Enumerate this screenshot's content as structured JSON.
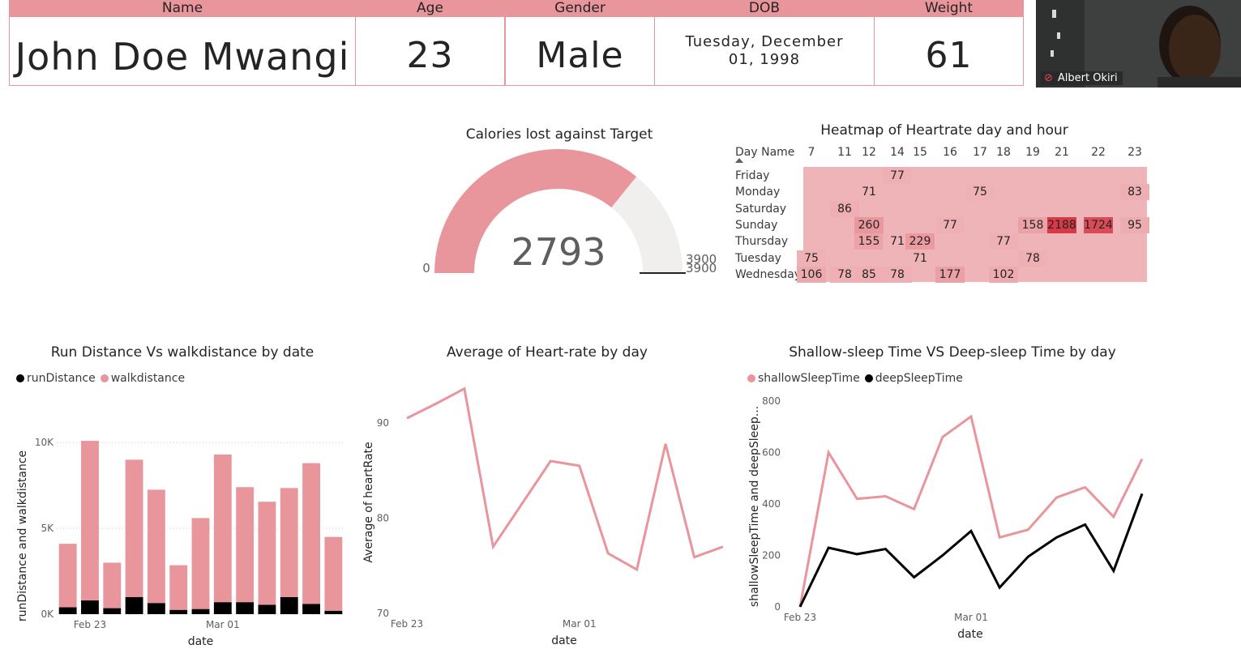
{
  "cards": [
    {
      "label": "Name",
      "value": "John Doe Mwangi"
    },
    {
      "label": "Age",
      "value": "23"
    },
    {
      "label": "Gender",
      "value": "Male"
    },
    {
      "label": "DOB",
      "value": "Tuesday, December 01, 1998"
    },
    {
      "label": "Weight",
      "value": "61"
    }
  ],
  "webcam": {
    "participant": "Albert Okiri"
  },
  "gauge": {
    "title": "Calories lost against Target",
    "value": 2793,
    "value_label": "2793",
    "min": 0,
    "min_label": "0",
    "max": 3900,
    "max_label": "3900",
    "target": 3900,
    "target_label": "3900",
    "fill_color": "#e8959b",
    "track_color": "#f0efee"
  },
  "heatmap": {
    "title": "Heatmap of Heartrate day and hour",
    "row_header": "Day Name",
    "columns": [
      "7",
      "11",
      "12",
      "14",
      "15",
      "16",
      "17",
      "18",
      "19",
      "21",
      "22",
      "23"
    ],
    "rows": [
      "Friday",
      "Monday",
      "Saturday",
      "Sunday",
      "Thursday",
      "Tuesday",
      "Wednesday"
    ],
    "cells": [
      {
        "row": 0,
        "col": 3,
        "value": "77"
      },
      {
        "row": 1,
        "col": 2,
        "value": "71"
      },
      {
        "row": 1,
        "col": 6,
        "value": "75"
      },
      {
        "row": 1,
        "col": 11,
        "value": "83"
      },
      {
        "row": 2,
        "col": 1,
        "value": "86"
      },
      {
        "row": 3,
        "col": 2,
        "value": "260"
      },
      {
        "row": 3,
        "col": 5,
        "value": "77"
      },
      {
        "row": 3,
        "col": 8,
        "value": "158"
      },
      {
        "row": 3,
        "col": 9,
        "value": "2188"
      },
      {
        "row": 3,
        "col": 10,
        "value": "1724"
      },
      {
        "row": 3,
        "col": 11,
        "value": "95"
      },
      {
        "row": 4,
        "col": 2,
        "value": "155"
      },
      {
        "row": 4,
        "col": 3,
        "value": "71"
      },
      {
        "row": 4,
        "col": 4,
        "value": "229"
      },
      {
        "row": 4,
        "col": 7,
        "value": "77"
      },
      {
        "row": 5,
        "col": 0,
        "value": "75"
      },
      {
        "row": 5,
        "col": 4,
        "value": "71"
      },
      {
        "row": 5,
        "col": 8,
        "value": "78"
      },
      {
        "row": 6,
        "col": 0,
        "value": "106"
      },
      {
        "row": 6,
        "col": 1,
        "value": "78"
      },
      {
        "row": 6,
        "col": 2,
        "value": "85"
      },
      {
        "row": 6,
        "col": 3,
        "value": "78"
      },
      {
        "row": 6,
        "col": 5,
        "value": "177"
      },
      {
        "row": 6,
        "col": 7,
        "value": "102"
      }
    ]
  },
  "chart_data": [
    {
      "type": "bar",
      "stacked": true,
      "title": "Run Distance Vs walkdistance by date",
      "xlabel": "date",
      "ylabel": "runDistance and walkdistance",
      "x_tick_labels": [
        "Feb 23",
        "Mar 01"
      ],
      "y_tick_labels": [
        "0K",
        "5K",
        "10K"
      ],
      "ylim": [
        0,
        11000
      ],
      "categories": [
        "Feb 22",
        "Feb 23",
        "Feb 24",
        "Feb 25",
        "Feb 26",
        "Feb 27",
        "Feb 28",
        "Mar 01",
        "Mar 02",
        "Mar 03",
        "Mar 04",
        "Mar 05",
        "Mar 06"
      ],
      "series": [
        {
          "name": "runDistance",
          "color": "#000000",
          "values": [
            400,
            800,
            350,
            1000,
            650,
            250,
            300,
            700,
            700,
            550,
            1000,
            600,
            200
          ]
        },
        {
          "name": "walkdistance",
          "color": "#e8959b",
          "values": [
            3700,
            9300,
            2650,
            8000,
            6600,
            2600,
            5300,
            8600,
            6700,
            6000,
            6350,
            8200,
            4300
          ]
        }
      ]
    },
    {
      "type": "line",
      "title": "Average of Heart-rate by day",
      "xlabel": "date",
      "ylabel": "Average of heartRate",
      "x_tick_labels": [
        "Feb 23",
        "Mar 01"
      ],
      "y_tick_labels": [
        "70",
        "80",
        "90"
      ],
      "ylim": [
        70,
        94
      ],
      "x": [
        "Feb 23",
        "Feb 24",
        "Feb 25",
        "Feb 26",
        "Feb 27",
        "Feb 28",
        "Mar 01",
        "Mar 02",
        "Mar 03",
        "Mar 04",
        "Mar 05",
        "Mar 06"
      ],
      "series": [
        {
          "name": "Average of heartRate",
          "color": "#e8959b",
          "values": [
            90.5,
            92,
            93.6,
            77,
            81.5,
            86,
            85.5,
            76.3,
            74.6,
            87.8,
            75.9,
            77
          ]
        }
      ]
    },
    {
      "type": "line",
      "title": "Shallow-sleep Time VS Deep-sleep Time by day",
      "xlabel": "date",
      "ylabel": "shallowSleepTime and deepSleep...",
      "x_tick_labels": [
        "Feb 23",
        "Mar 01"
      ],
      "y_tick_labels": [
        "0",
        "200",
        "400",
        "600",
        "800"
      ],
      "ylim": [
        0,
        800
      ],
      "x": [
        "Feb 23",
        "Feb 24",
        "Feb 25",
        "Feb 26",
        "Feb 27",
        "Feb 28",
        "Mar 01",
        "Mar 02",
        "Mar 03",
        "Mar 04",
        "Mar 05",
        "Mar 06",
        "Mar 07",
        "Mar 08",
        "Mar 09"
      ],
      "series": [
        {
          "name": "shallowSleepTime",
          "color": "#e8959b",
          "values": [
            0,
            600,
            420,
            430,
            380,
            660,
            740,
            270,
            300,
            425,
            465,
            350,
            575
          ]
        },
        {
          "name": "deepSleepTime",
          "color": "#000000",
          "values": [
            0,
            230,
            205,
            225,
            115,
            200,
            295,
            75,
            195,
            270,
            320,
            140,
            440
          ]
        }
      ]
    }
  ]
}
